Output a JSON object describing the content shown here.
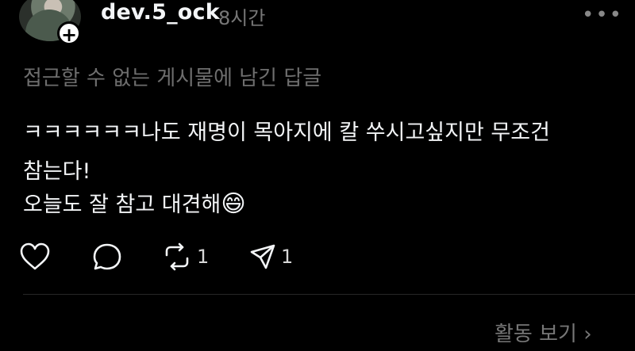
{
  "post": {
    "username": "dev.5_ock",
    "time": "8시간",
    "more_label": "•••",
    "add_label": "+",
    "notice": "접근할 수 없는 게시물에 남긴 답글",
    "lines": [
      "ㅋㅋㅋㅋㅋㅋ나도 재명이 목아지에 칼 쑤시고싶지만 무조건",
      "참는다!",
      "오늘도 잘 참고 대견해"
    ],
    "emoji": "😄",
    "actions": {
      "like_count": "",
      "comment_count": "",
      "repost_count": "1",
      "share_count": "1"
    },
    "activity_label": "활동 보기",
    "activity_chevron": "›"
  },
  "icons": {
    "like": "heart-icon",
    "comment": "speech-bubble-icon",
    "repost": "repost-icon",
    "share": "send-icon"
  }
}
